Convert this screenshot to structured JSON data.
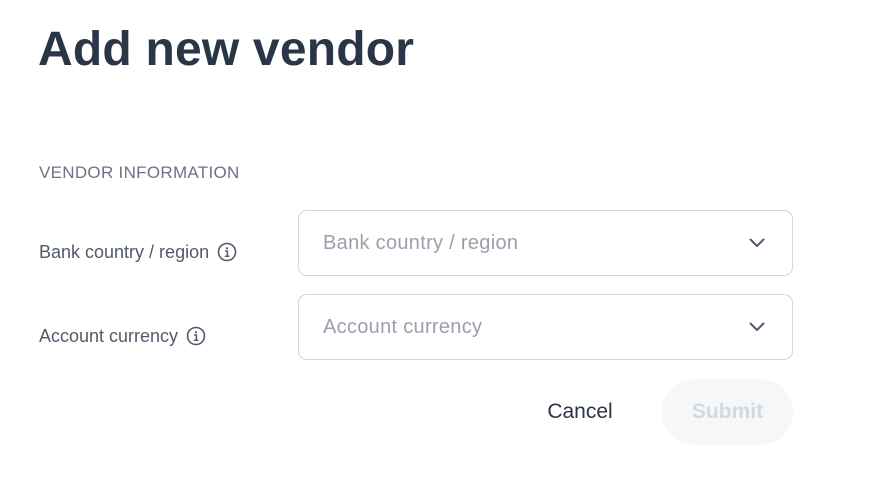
{
  "page": {
    "title": "Add new vendor"
  },
  "vendor_information": {
    "heading": "VENDOR INFORMATION",
    "bank_country": {
      "label": "Bank country / region",
      "placeholder": "Bank country / region",
      "info_icon": "info-circle-icon",
      "dropdown_icon": "chevron-down-icon"
    },
    "account_currency": {
      "label": "Account currency",
      "placeholder": "Account currency",
      "info_icon": "info-circle-icon",
      "dropdown_icon": "chevron-down-icon"
    }
  },
  "actions": {
    "cancel_label": "Cancel",
    "submit_label": "Submit",
    "submit_disabled": true
  },
  "colors": {
    "title": "#2a3547",
    "label": "#505a6b",
    "placeholder": "#9aa0ab",
    "border": "#d3d7de",
    "submit_bg_disabled": "#f6f7f9",
    "submit_text_disabled": "#d4d8df"
  }
}
